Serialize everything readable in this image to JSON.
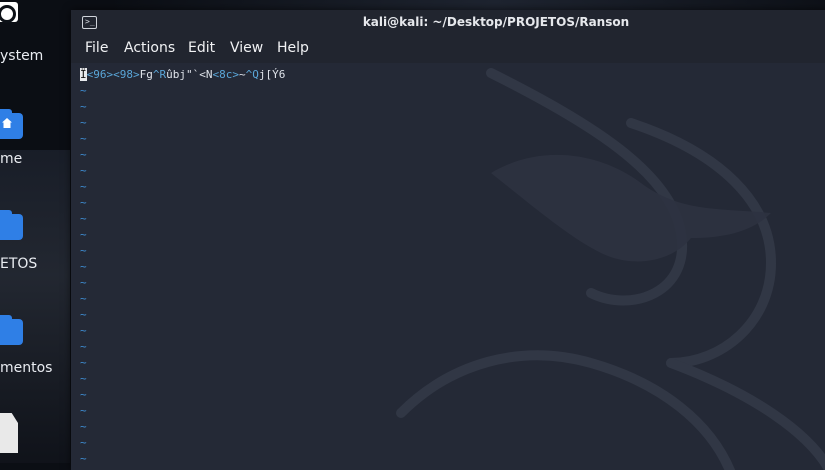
{
  "desktop": {
    "icons": [
      {
        "label": "ystem",
        "icon": "system-icon"
      },
      {
        "label": "me",
        "icon": "home-folder-icon"
      },
      {
        "label": "ETOS",
        "icon": "folder-icon"
      },
      {
        "label": "mentos",
        "icon": "folder-icon"
      },
      {
        "label": "",
        "icon": "file-icon"
      }
    ]
  },
  "window": {
    "title": "kali@kali: ~/Desktop/PROJETOS/Ranson",
    "icon": "terminal-icon",
    "menu": [
      "File",
      "Actions",
      "Edit",
      "View",
      "Help"
    ]
  },
  "terminal": {
    "first_line": [
      {
        "t": "Ï",
        "k": "cursor"
      },
      {
        "t": "<96>",
        "k": "ctl"
      },
      {
        "t": "<98>",
        "k": "ctl"
      },
      {
        "t": "Fg",
        "k": "txt"
      },
      {
        "t": "^R",
        "k": "ctl"
      },
      {
        "t": "ûbj\"`",
        "k": "txt"
      },
      {
        "t": "<N",
        "k": "txt"
      },
      {
        "t": "<8c>",
        "k": "ctl"
      },
      {
        "t": "~",
        "k": "txt"
      },
      {
        "t": "^Q",
        "k": "ctl"
      },
      {
        "t": "j[Ý6",
        "k": "txt"
      }
    ],
    "tilde_char": "~",
    "tilde_count": 25
  },
  "colors": {
    "control_chars": "#5aa6d8",
    "tilde": "#3f8fd6",
    "terminal_bg": "#242936"
  }
}
